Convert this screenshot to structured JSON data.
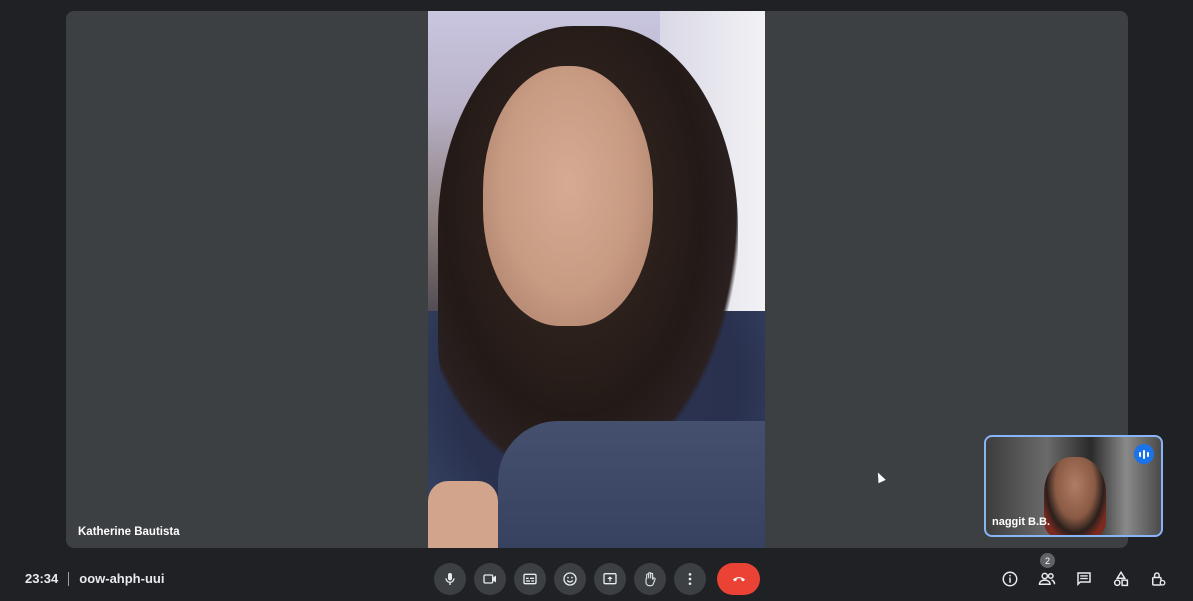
{
  "main_tile": {
    "participant_name": "Katherine Bautista"
  },
  "self_view": {
    "participant_name": "naggit B.B."
  },
  "bottom_bar": {
    "time": "23:34",
    "meeting_code": "oow-ahph-uui",
    "controls": [
      {
        "name": "mic",
        "icon": "microphone-icon"
      },
      {
        "name": "camera",
        "icon": "video-camera-icon"
      },
      {
        "name": "captions",
        "icon": "closed-captions-icon"
      },
      {
        "name": "reactions",
        "icon": "emoji-icon"
      },
      {
        "name": "present",
        "icon": "present-screen-icon"
      },
      {
        "name": "raise-hand",
        "icon": "hand-icon"
      },
      {
        "name": "more-options",
        "icon": "more-vertical-icon"
      },
      {
        "name": "leave-call",
        "icon": "end-call-icon",
        "color": "#ea4335"
      }
    ],
    "people_count": "2",
    "right_icons": [
      "info-icon",
      "people-icon",
      "chat-icon",
      "activities-icon",
      "host-controls-icon"
    ]
  },
  "colors": {
    "background": "#202124",
    "tile": "#3c4043",
    "accent": "#8ab4f8",
    "end_call": "#ea4335"
  }
}
